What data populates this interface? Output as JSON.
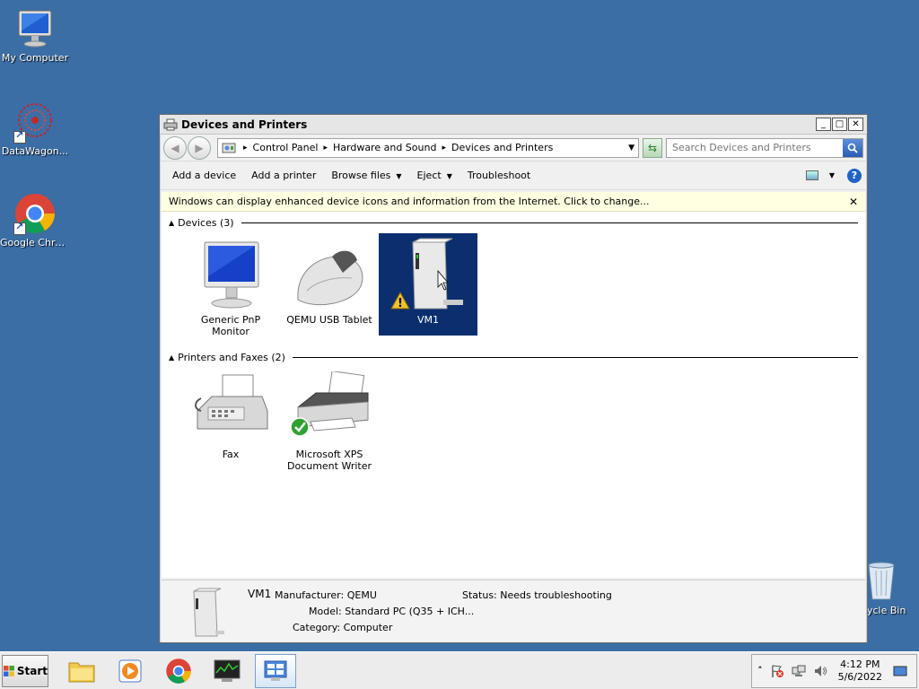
{
  "desktop": {
    "icons": [
      {
        "label": "My Computer"
      },
      {
        "label": "DataWagon..."
      },
      {
        "label": "Google Chrome"
      },
      {
        "label": "ycle Bin"
      }
    ]
  },
  "window": {
    "title": "Devices and Printers",
    "controls": {
      "minimize": "_",
      "maximize": "□",
      "close": "✕"
    },
    "nav": {
      "back": "◀",
      "forward": "▶"
    },
    "breadcrumb": [
      "Control Panel",
      "Hardware and Sound",
      "Devices and Printers"
    ],
    "search_placeholder": "Search Devices and Printers",
    "toolbar": {
      "add_device": "Add a device",
      "add_printer": "Add a printer",
      "browse_files": "Browse files",
      "eject": "Eject",
      "troubleshoot": "Troubleshoot"
    },
    "infobar": "Windows can display enhanced device icons and information from the Internet. Click to change...",
    "groups": [
      {
        "title": "Devices (3)",
        "items": [
          {
            "label": "Generic PnP Monitor",
            "icon": "monitor-icon"
          },
          {
            "label": "QEMU USB Tablet",
            "icon": "mouse-icon"
          },
          {
            "label": "VM1",
            "icon": "computer-tower-icon",
            "selected": true
          }
        ]
      },
      {
        "title": "Printers and Faxes (2)",
        "items": [
          {
            "label": "Fax",
            "icon": "fax-icon"
          },
          {
            "label": "Microsoft XPS Document Writer",
            "icon": "printer-icon"
          }
        ]
      }
    ],
    "details": {
      "name": "VM1",
      "manufacturer_label": "Manufacturer:",
      "manufacturer": "QEMU",
      "model_label": "Model:",
      "model": "Standard PC (Q35 + ICH...",
      "category_label": "Category:",
      "category": "Computer",
      "status_label": "Status:",
      "status": "Needs troubleshooting"
    }
  },
  "taskbar": {
    "start": "Start",
    "clock_time": "4:12 PM",
    "clock_date": "5/6/2022",
    "tray_expand": "˄"
  }
}
